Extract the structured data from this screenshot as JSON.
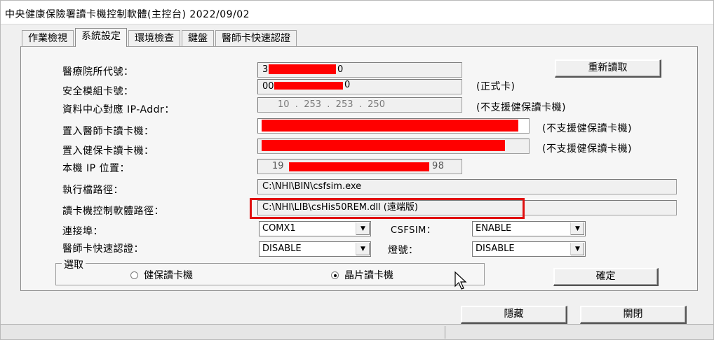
{
  "window": {
    "title": "中央健康保險署讀卡機控制軟體(主控台) 2022/09/02"
  },
  "tabs": [
    {
      "label": "作業檢視"
    },
    {
      "label": "系統設定"
    },
    {
      "label": "環境檢查"
    },
    {
      "label": "鍵盤"
    },
    {
      "label": "醫師卡快速認證"
    }
  ],
  "form": {
    "hospital_code_label": "醫療院所代號：",
    "hospital_code_prefix": "3",
    "hospital_code_suffix": "0",
    "sam_label": "安全模組卡號：",
    "sam_prefix": "00",
    "sam_suffix": "0",
    "sam_note": "(正式卡)",
    "ip_label": "資料中心對應 IP-Addr：",
    "ip_value": "10  .  253  .  253  .  250",
    "ip_note": "(不支援健保讀卡機)",
    "doctor_reader_label": "置入醫師卡讀卡機：",
    "doctor_reader_note": "(不支援健保讀卡機)",
    "nhi_reader_label": "置入健保卡讀卡機：",
    "nhi_reader_note": "(不支援健保讀卡機)",
    "local_ip_label": "本機 IP 位置：",
    "local_ip_prefix": "19",
    "local_ip_suffix": "98",
    "exe_path_label": "執行檔路徑：",
    "exe_path_value": "C:\\NHI\\BIN\\csfsim.exe",
    "dll_path_label": "讀卡機控制軟體路徑：",
    "dll_path_value": "C:\\NHI\\LIB\\csHis50REM.dll (遠端版)",
    "port_label": "連接埠：",
    "port_value": "COMX1",
    "csfsim_label": "CSFSIM：",
    "csfsim_value": "ENABLE",
    "fast_auth_label": "醫師卡快速認證：",
    "fast_auth_value": "DISABLE",
    "light_label": "燈號：",
    "light_value": "DISABLE"
  },
  "group": {
    "legend": "選取",
    "option_nhi": "健保讀卡機",
    "option_chip": "晶片讀卡機",
    "selected": "晶片讀卡機"
  },
  "buttons": {
    "reload": "重新讀取",
    "confirm": "確定",
    "hide": "隱藏",
    "close": "關閉"
  },
  "colors": {
    "redaction": "#ff0000",
    "highlight": "#e01010"
  }
}
